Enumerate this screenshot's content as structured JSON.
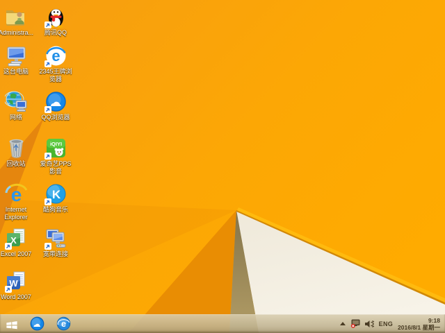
{
  "wallpaper": {
    "base_top": "#f69d12",
    "base_bright": "#ffab00",
    "facet_dark_left": "#e5860e",
    "facet_lower_tint": "#ef9405",
    "facet_deep_orange": "#e98d03",
    "facet_khaki_top": "#84744a",
    "facet_khaki_bottom": "#b29d66",
    "facet_white_top": "#efe9da",
    "facet_white_bottom": "#f7f3e8",
    "crease_highlight": "#ffbb10",
    "crease_shadow": "#c98208"
  },
  "desktop_icons": [
    {
      "label": "Administra...",
      "name": "administrator-folder"
    },
    {
      "label": "腾讯QQ",
      "name": "tencent-qq"
    },
    {
      "label": "这台电脑",
      "name": "this-pc"
    },
    {
      "label": "2345王牌浏览器",
      "name": "2345-browser"
    },
    {
      "label": "网络",
      "name": "network"
    },
    {
      "label": "QQ浏览器",
      "name": "qq-browser"
    },
    {
      "label": "回收站",
      "name": "recycle-bin"
    },
    {
      "label": "爱奇艺PPS 影音",
      "name": "iqiyi-pps"
    },
    {
      "label": "Internet Explorer",
      "name": "internet-explorer"
    },
    {
      "label": "酷狗音乐",
      "name": "kugou-music"
    },
    {
      "label": "Excel 2007",
      "name": "excel-2007"
    },
    {
      "label": "宽带连接",
      "name": "broadband-connection"
    },
    {
      "label": "Word 2007",
      "name": "word-2007"
    }
  ],
  "icon_glyphs": {
    "iqiyi_logo": "iQIYI",
    "kugou_k": "K",
    "ie_e": "e",
    "e2345": "e",
    "ie_taskbar_e": "e",
    "excel_x": "X",
    "word_w": "W"
  },
  "taskbar": {
    "tray": {
      "language": "ENG",
      "time": "9:18",
      "date": "2016/8/1 星期一"
    }
  }
}
